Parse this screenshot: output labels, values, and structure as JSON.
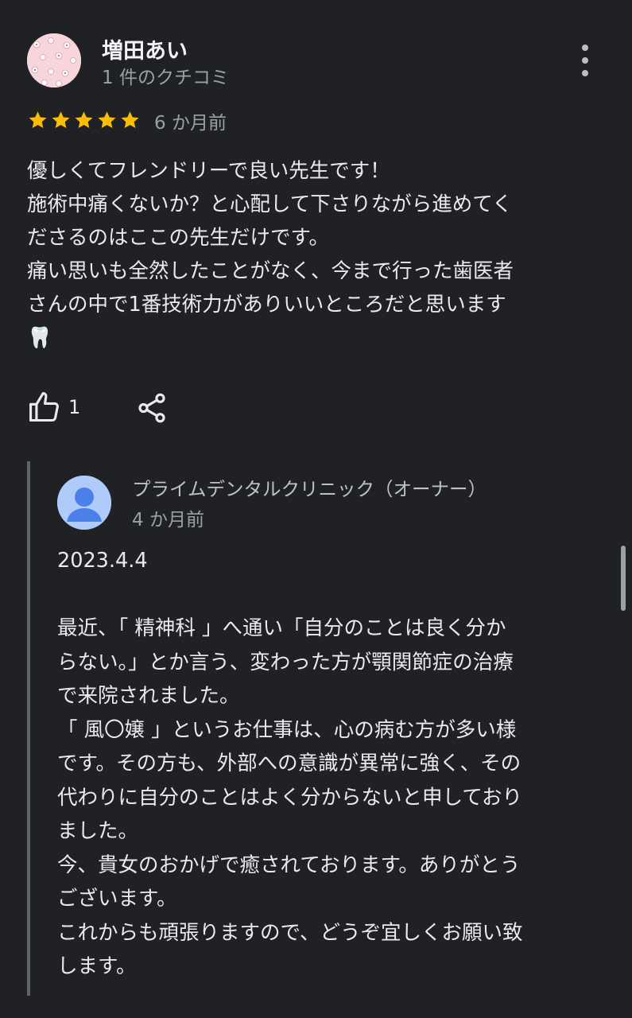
{
  "review": {
    "reviewer_name": "増田あい",
    "review_count": "1 件のクチコミ",
    "rating": 5,
    "rating_max": 5,
    "date": "6 か月前",
    "text": "優しくてフレンドリーで良い先生です！\n施術中痛くないか？と心配して下さりながら進めてく\nださるのはここの先生だけです。\n痛い思いも全然したことがなく、今まで行った歯医者\nさんの中で1番技術力がありいいところだと思います\n🦷",
    "like_count": "1",
    "icons": {
      "avatar": "floral-pattern-avatar",
      "more": "more-vert-icon",
      "star": "star-icon",
      "like": "thumb-up-icon",
      "share": "share-icon"
    }
  },
  "reply": {
    "owner_name": "プライムデンタルクリニック（オーナー）",
    "date": "4 か月前",
    "text": "2023.4.4\n\n最近、「 精神科 」へ通い「自分のことは良く分か\nらない。」とか言う、変わった方が顎関節症の治療\nで来院されました。\n「 風〇嬢 」というお仕事は、心の病む方が多い様\nです。その方も、外部への意識が異常に強く、その\n代わりに自分のことはよく分からないと申しており\nました。\n今、貴女のおかげで癒されております。ありがとう\nございます。\nこれからも頑張りますので、どうぞ宜しくお願い致\nします。",
    "icons": {
      "avatar": "person-icon"
    }
  },
  "colors": {
    "background": "#202124",
    "star": "#fbbc04",
    "text": "#e8eaed",
    "secondary_text": "#9aa0a6",
    "owner_avatar_bg": "#aecbfa",
    "owner_avatar_fg": "#4a80e8"
  }
}
